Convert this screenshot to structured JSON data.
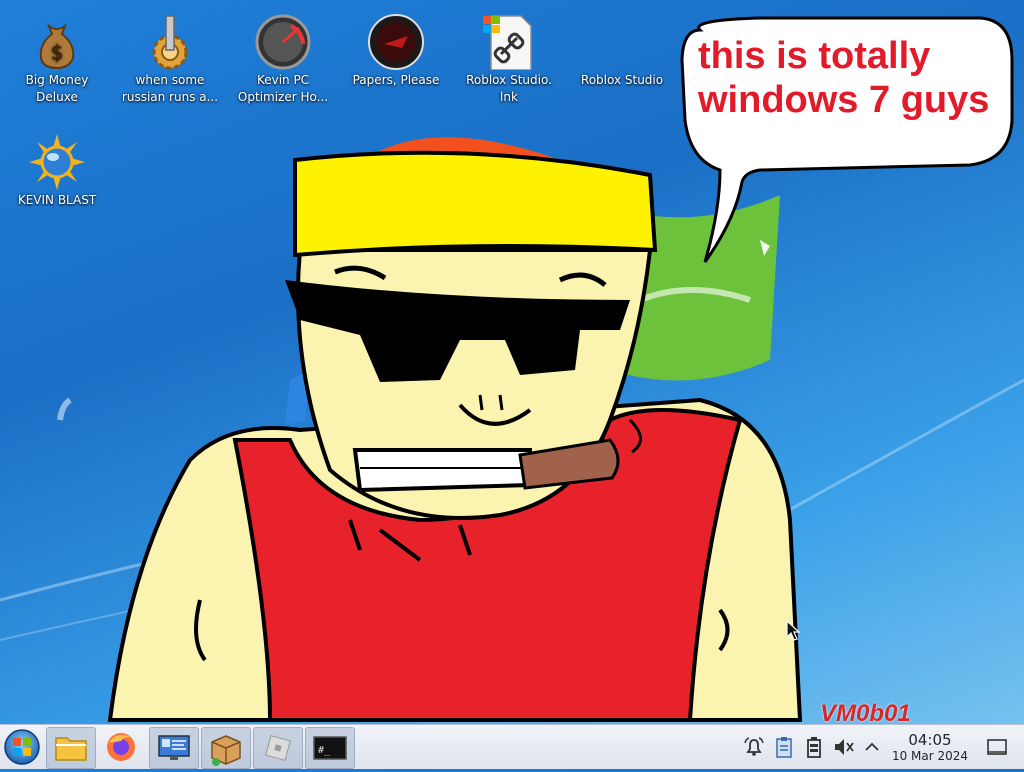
{
  "desktop": {
    "icons": [
      {
        "label": "Big Money Deluxe",
        "icon": "money-bag-icon"
      },
      {
        "label": "when some russian runs a...",
        "icon": "gear-icon"
      },
      {
        "label": "Kevin PC Optimizer Ho...",
        "icon": "speedometer-icon"
      },
      {
        "label": "Papers, Please",
        "icon": "papers-please-icon"
      },
      {
        "label": "Roblox Studio. lnk",
        "icon": "shortcut-file-icon"
      },
      {
        "label": "Roblox Studio",
        "icon": "roblox-studio-icon"
      },
      {
        "label": "KEVIN BLAST",
        "icon": "sun-globe-icon"
      }
    ]
  },
  "wallpaper": {
    "speech_bubble_text": "this is totally windows 7 guys",
    "signature": "VM0b01"
  },
  "taskbar": {
    "start_icon": "windows-start-icon",
    "pinned": [
      {
        "name": "file-manager",
        "icon": "folder-icon"
      },
      {
        "name": "firefox",
        "icon": "firefox-icon"
      },
      {
        "name": "system-monitor",
        "icon": "monitor-icon"
      },
      {
        "name": "package-installer",
        "icon": "package-icon"
      },
      {
        "name": "roblox",
        "icon": "roblox-icon"
      },
      {
        "name": "terminal",
        "icon": "terminal-icon"
      }
    ],
    "terminal_glyph": "#_",
    "tray": {
      "icons": [
        "notification-bell-icon",
        "clipboard-icon",
        "battery-icon",
        "volume-muted-icon",
        "expand-arrow-icon"
      ],
      "time": "04:05",
      "date": "10 Mar 2024"
    }
  },
  "colors": {
    "desktop_blue": "#1f7fd8",
    "bubble_text_red": "#e21b2a",
    "shirt_red": "#e8222a",
    "headband_yellow": "#fff200",
    "skin": "#fbf3b0"
  }
}
